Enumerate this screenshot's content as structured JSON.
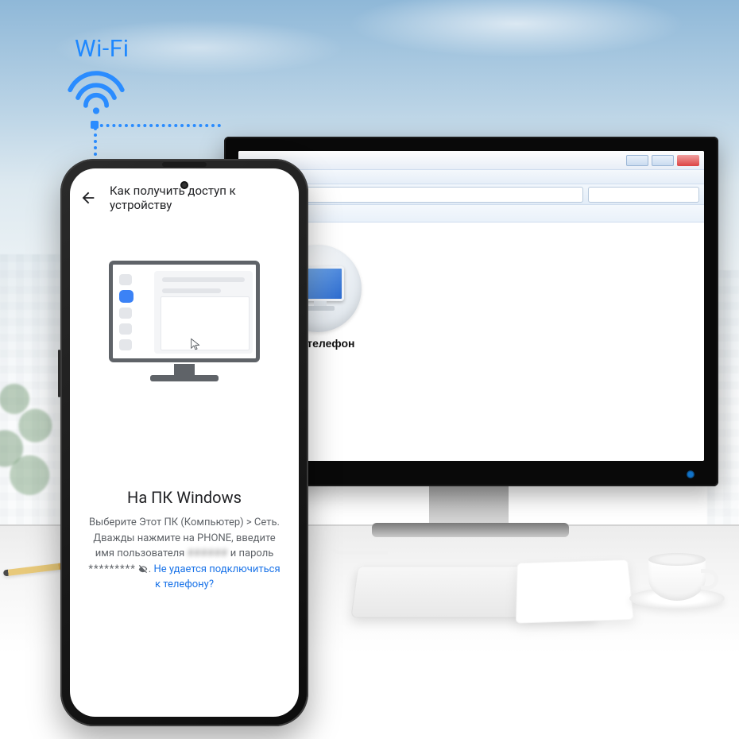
{
  "wifi": {
    "label": "Wi-Fi"
  },
  "explorer": {
    "device_label": "Мой телефон"
  },
  "phone": {
    "title": "Как получить доступ к устройству",
    "instructions": {
      "heading": "На ПК Windows",
      "body_pre": "Выберите Этот ПК (Компьютер) > Сеть. Дважды нажмите на PHONE, введите имя пользователя ",
      "username_masked": "######",
      "body_mid": " и пароль ",
      "password_masked": "*********",
      "body_post": ". ",
      "link": "Не удается подключиться к телефону?"
    }
  }
}
